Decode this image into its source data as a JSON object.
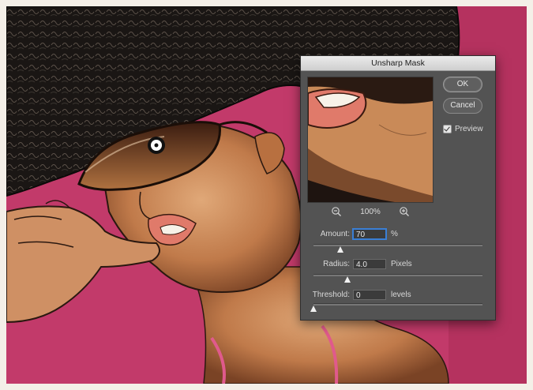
{
  "dialog": {
    "title": "Unsharp Mask",
    "ok_label": "OK",
    "cancel_label": "Cancel",
    "preview_label": "Preview",
    "preview_checked": true,
    "zoom_level": "100%"
  },
  "params": {
    "amount": {
      "label": "Amount:",
      "value": "70",
      "unit": "%",
      "level": 0.16
    },
    "radius": {
      "label": "Radius:",
      "value": "4.0",
      "unit": "Pixels",
      "level": 0.2
    },
    "threshold": {
      "label": "Threshold:",
      "value": "0",
      "unit": "levels",
      "level": 0.0
    }
  },
  "colors": {
    "background_pink": "#c23a6a",
    "dialog_gray": "#535353",
    "focus_blue": "#3a7fd5"
  }
}
